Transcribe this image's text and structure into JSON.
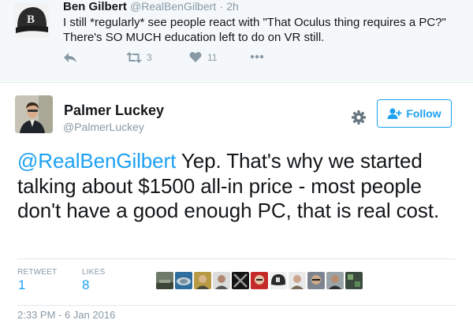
{
  "reply": {
    "name": "Ben Gilbert",
    "handle": "@RealBenGilbert",
    "separator": "·",
    "time": "2h",
    "text_line1": "I still *regularly* see people react with \"That Oculus thing requires a PC?\"",
    "text_line2": "There's SO MUCH education left to do on VR still.",
    "actions": {
      "reply_icon": "reply-arrow-icon",
      "retweet_icon": "retweet-icon",
      "retweet_count": "3",
      "like_icon": "heart-icon",
      "like_count": "11",
      "more_icon": "more-dots-icon"
    },
    "avatar_letter": "B"
  },
  "tweet": {
    "name": "Palmer Luckey",
    "handle": "@PalmerLuckey",
    "follow_label": "Follow",
    "mention": "@RealBenGilbert",
    "text": " Yep.  That's why we started talking about $1500 all-in price - most people don't have a good enough PC, that is real cost.",
    "stats": {
      "retweet_label": "RETWEET",
      "retweet_value": "1",
      "likes_label": "LIKES",
      "likes_value": "8"
    },
    "timestamp": "2:33 PM - 6 Jan 2016"
  },
  "colors": {
    "accent": "#1da1f2",
    "muted": "#8899a6",
    "text": "#14171a",
    "reply_bg": "#f5f8fa"
  }
}
